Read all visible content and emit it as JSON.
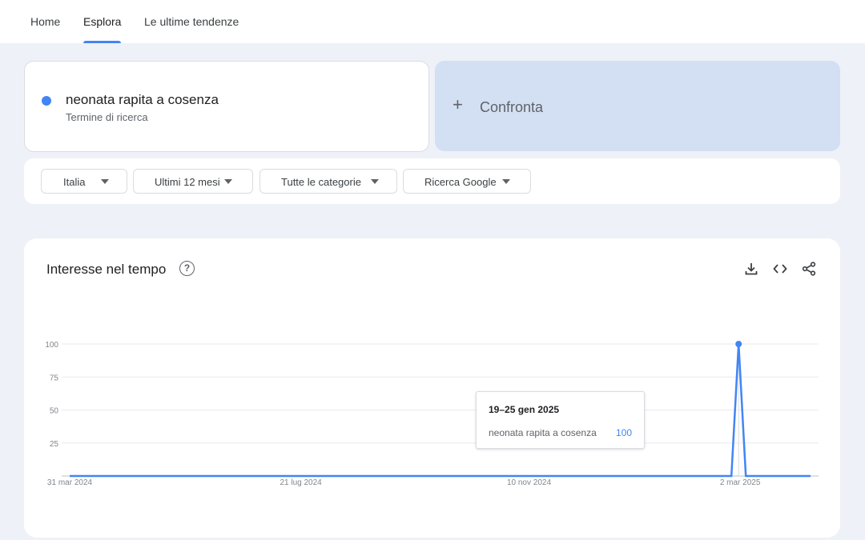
{
  "nav": {
    "tabs": [
      {
        "label": "Home"
      },
      {
        "label": "Esplora"
      },
      {
        "label": "Le ultime tendenze"
      }
    ]
  },
  "search_term": {
    "title": "neonata rapita a cosenza",
    "subtitle": "Termine di ricerca",
    "color": "#4285f4"
  },
  "compare": {
    "icon": "plus-icon",
    "label": "Confronta"
  },
  "filters": [
    {
      "label": "Italia"
    },
    {
      "label": "Ultimi 12 mesi"
    },
    {
      "label": "Tutte le categorie"
    },
    {
      "label": "Ricerca Google"
    }
  ],
  "chart_section": {
    "title": "Interesse nel tempo",
    "icons": [
      "help-icon",
      "download-icon",
      "embed-icon",
      "share-icon"
    ],
    "tooltip": {
      "date": "19–25 gen 2025",
      "term": "neonata rapita a cosenza",
      "value": "100"
    }
  },
  "chart_data": {
    "type": "line",
    "yticks": [
      100,
      75,
      50,
      25
    ],
    "ylim": [
      0,
      100
    ],
    "xticks": [
      "31 mar 2024",
      "21 lug 2024",
      "10 nov 2024",
      "2 mar 2025"
    ],
    "grid": true,
    "series": [
      {
        "name": "neonata rapita a cosenza",
        "color": "#4285f4",
        "values": [
          0,
          0,
          0,
          0,
          0,
          0,
          0,
          0,
          0,
          0,
          0,
          0,
          0,
          0,
          0,
          0,
          0,
          0,
          0,
          0,
          0,
          0,
          0,
          0,
          0,
          0,
          0,
          0,
          0,
          0,
          0,
          0,
          0,
          0,
          0,
          0,
          0,
          0,
          0,
          0,
          0,
          0,
          0,
          0,
          0,
          0,
          0,
          0,
          0,
          0,
          0,
          0,
          0,
          0,
          0,
          0,
          0,
          0,
          0,
          0,
          0,
          0,
          0,
          0,
          0,
          0,
          0,
          0,
          0,
          0,
          0,
          0,
          0,
          0,
          0,
          0,
          0,
          0,
          0,
          0,
          0,
          0,
          0,
          0,
          0,
          0,
          0,
          0,
          0,
          0,
          0,
          0,
          0,
          100,
          0,
          0,
          0,
          0,
          0,
          0,
          0,
          0,
          0,
          0
        ]
      }
    ]
  }
}
